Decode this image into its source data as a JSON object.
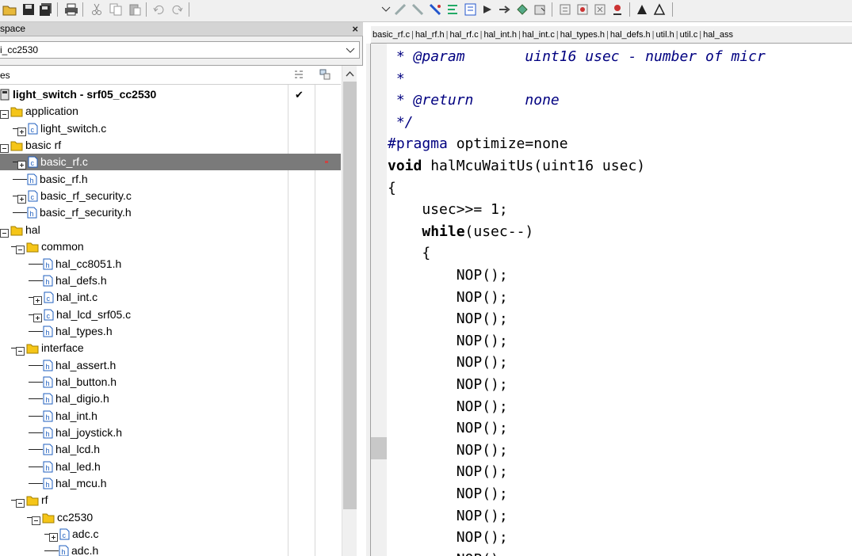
{
  "workspace": {
    "title": "space",
    "close_label": "×",
    "config_value": "i_cc2530",
    "files_header": "es"
  },
  "tree": {
    "rows": [
      {
        "label": "light_switch - srf05_cc2530",
        "check": "✔"
      },
      {
        "label": "application"
      },
      {
        "label": "light_switch.c"
      },
      {
        "label": "basic rf"
      },
      {
        "label": "basic_rf.c"
      },
      {
        "label": "basic_rf.h"
      },
      {
        "label": "basic_rf_security.c"
      },
      {
        "label": "basic_rf_security.h"
      },
      {
        "label": "hal"
      },
      {
        "label": "common"
      },
      {
        "label": "hal_cc8051.h"
      },
      {
        "label": "hal_defs.h"
      },
      {
        "label": "hal_int.c"
      },
      {
        "label": "hal_lcd_srf05.c"
      },
      {
        "label": "hal_types.h"
      },
      {
        "label": "interface"
      },
      {
        "label": "hal_assert.h"
      },
      {
        "label": "hal_button.h"
      },
      {
        "label": "hal_digio.h"
      },
      {
        "label": "hal_int.h"
      },
      {
        "label": "hal_joystick.h"
      },
      {
        "label": "hal_lcd.h"
      },
      {
        "label": "hal_led.h"
      },
      {
        "label": "hal_mcu.h"
      },
      {
        "label": "rf"
      },
      {
        "label": "cc2530"
      },
      {
        "label": "adc.c"
      },
      {
        "label": "adc.h"
      }
    ]
  },
  "editor": {
    "tabs": [
      "basic_rf.c",
      "hal_rf.h",
      "hal_rf.c",
      "hal_int.h",
      "hal_int.c",
      "hal_types.h",
      "hal_defs.h",
      "util.h",
      "util.c",
      "hal_ass"
    ],
    "lines": [
      {
        "p1": " * ",
        "c1": "@param",
        "p2": "       ",
        "c2": "uint16 usec - number of micr"
      },
      {
        "c1": " *"
      },
      {
        "p1": " * ",
        "c1": "@return",
        "p2": "      ",
        "c2": "none"
      },
      {
        "c1": " */"
      },
      {
        "pp": "#pragma",
        "t": " optimize=none"
      },
      {
        "kw": "void",
        "t": " halMcuWaitUs(uint16 usec)"
      },
      {
        "t": "{"
      },
      {
        "t": "    usec>>= 1;"
      },
      {
        "t": "    ",
        "kw": "while",
        "t2": "(usec--)"
      },
      {
        "t": "    {"
      },
      {
        "t": "        NOP();"
      },
      {
        "t": "        NOP();"
      },
      {
        "t": "        NOP();"
      },
      {
        "t": "        NOP();"
      },
      {
        "t": "        NOP();"
      },
      {
        "t": "        NOP();"
      },
      {
        "t": "        NOP();"
      },
      {
        "t": "        NOP();"
      },
      {
        "t": "        NOP();"
      },
      {
        "t": "        NOP();"
      },
      {
        "t": "        NOP();"
      },
      {
        "t": "        NOP();"
      },
      {
        "t": "        NOP();"
      },
      {
        "t": "        NOP();"
      }
    ]
  },
  "colors": {
    "selection": "#7a7a7a",
    "comment": "#000080",
    "folder": "#f5c518",
    "file_icon": "#1f5fbf"
  }
}
